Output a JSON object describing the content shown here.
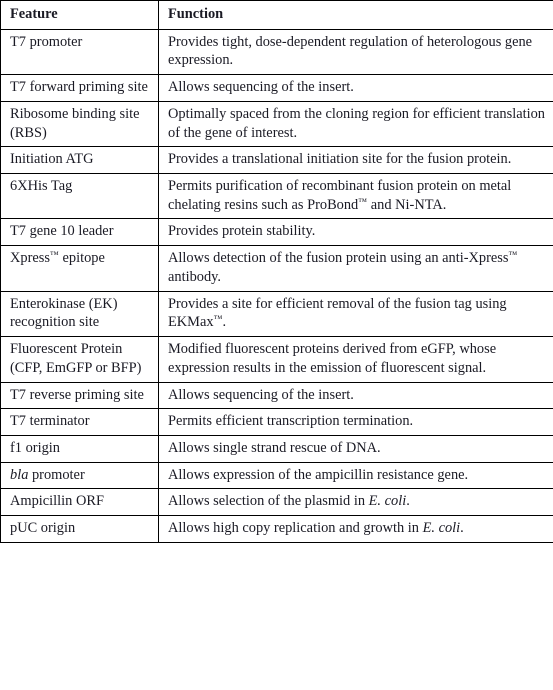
{
  "document": {
    "type": "feature-table",
    "background_color": "#ffffff",
    "text_color": "#1a1a24",
    "border_color": "#000000"
  },
  "table": {
    "columns": [
      {
        "key": "feature",
        "label": "Feature"
      },
      {
        "key": "function",
        "label": "Function"
      }
    ],
    "rows": [
      {
        "feature": "T7 promoter",
        "function": "Provides tight, dose-dependent regulation of heterologous gene expression."
      },
      {
        "feature": "T7 forward priming site",
        "function": "Allows sequencing of the insert."
      },
      {
        "feature": "Ribosome binding site (RBS)",
        "function": "Optimally spaced from the cloning region for efficient translation of the gene of interest."
      },
      {
        "feature": "Initiation ATG",
        "function": "Provides a translational initiation site for the fusion protein."
      },
      {
        "feature": "6XHis Tag",
        "function_parts": [
          {
            "text": "Permits purification of recombinant fusion protein on metal chelating resins such as ProBond"
          },
          {
            "text": "™",
            "style": "superscript-trademark"
          },
          {
            "text": " and Ni-NTA."
          }
        ]
      },
      {
        "feature": "T7 gene 10 leader",
        "function": "Provides protein stability."
      },
      {
        "feature_parts": [
          {
            "text": "Xpress"
          },
          {
            "text": "™",
            "style": "superscript-trademark"
          },
          {
            "text": " epitope"
          }
        ],
        "function_parts": [
          {
            "text": "Allows detection of the fusion protein using an anti-Xpress"
          },
          {
            "text": "™",
            "style": "superscript-trademark"
          },
          {
            "text": " antibody."
          }
        ]
      },
      {
        "feature": "Enterokinase (EK) recognition site",
        "function_parts": [
          {
            "text": "Provides a site for efficient removal of the fusion tag using EKMax"
          },
          {
            "text": "™",
            "style": "superscript-trademark"
          },
          {
            "text": "."
          }
        ]
      },
      {
        "feature": "Fluorescent Protein (CFP, EmGFP or BFP)",
        "function": "Modified fluorescent proteins derived from eGFP, whose expression results in the emission of fluorescent signal."
      },
      {
        "feature": "T7 reverse priming site",
        "function": "Allows sequencing of the insert."
      },
      {
        "feature": "T7 terminator",
        "function": "Permits efficient transcription termination."
      },
      {
        "feature": "f1 origin",
        "function": "Allows single strand rescue of DNA."
      },
      {
        "feature_parts": [
          {
            "text": "bla",
            "style": "italic"
          },
          {
            "text": " promoter"
          }
        ],
        "function": "Allows expression of the ampicillin resistance gene."
      },
      {
        "feature": "Ampicillin ORF",
        "function_parts": [
          {
            "text": "Allows selection of the plasmid in "
          },
          {
            "text": "E. coli",
            "style": "italic"
          },
          {
            "text": "."
          }
        ]
      },
      {
        "feature": "pUC origin",
        "function_parts": [
          {
            "text": "Allows high copy replication and growth in "
          },
          {
            "text": "E. coli",
            "style": "italic"
          },
          {
            "text": "."
          }
        ]
      }
    ]
  }
}
